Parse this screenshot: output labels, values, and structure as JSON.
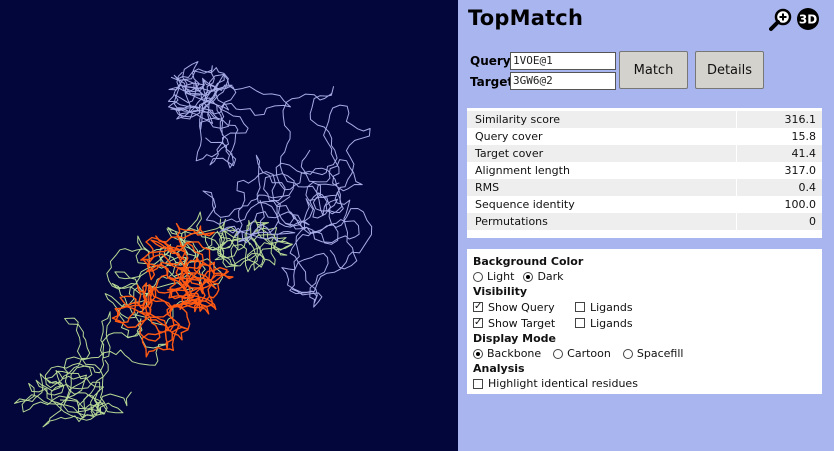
{
  "app": {
    "title": "TopMatch"
  },
  "icons": {
    "zoom": "magnifier-plus-icon",
    "view3d": "3d-view-icon"
  },
  "form": {
    "query_label": "Query",
    "query_value": "1VOE@1",
    "target_label": "Target",
    "target_value": "3GW6@2",
    "match_label": "Match",
    "details_label": "Details"
  },
  "stats": [
    {
      "label": "Similarity score",
      "value": "316.1"
    },
    {
      "label": "Query cover",
      "value": "15.8"
    },
    {
      "label": "Target cover",
      "value": "41.4"
    },
    {
      "label": "Alignment length",
      "value": "317.0"
    },
    {
      "label": "RMS",
      "value": "0.4"
    },
    {
      "label": "Sequence identity",
      "value": "100.0"
    },
    {
      "label": "Permutations",
      "value": "0"
    }
  ],
  "options": {
    "background": {
      "heading": "Background Color",
      "light": "Light",
      "dark": "Dark",
      "selected": "dark"
    },
    "visibility": {
      "heading": "Visibility",
      "show_query": "Show Query",
      "show_query_checked": true,
      "query_ligands": "Ligands",
      "query_ligands_checked": false,
      "show_target": "Show Target",
      "show_target_checked": true,
      "target_ligands": "Ligands",
      "target_ligands_checked": false
    },
    "display": {
      "heading": "Display Mode",
      "backbone": "Backbone",
      "cartoon": "Cartoon",
      "spacefill": "Spacefill",
      "selected": "backbone"
    },
    "analysis": {
      "heading": "Analysis",
      "highlight": "Highlight identical residues",
      "highlight_checked": false
    }
  },
  "colors": {
    "viewer_background": "#02063a",
    "panel_background": "#a9b5ee",
    "query_chain": "#a7abe6",
    "target_chain": "#b7d995",
    "aligned_region": "#ff5a14"
  }
}
